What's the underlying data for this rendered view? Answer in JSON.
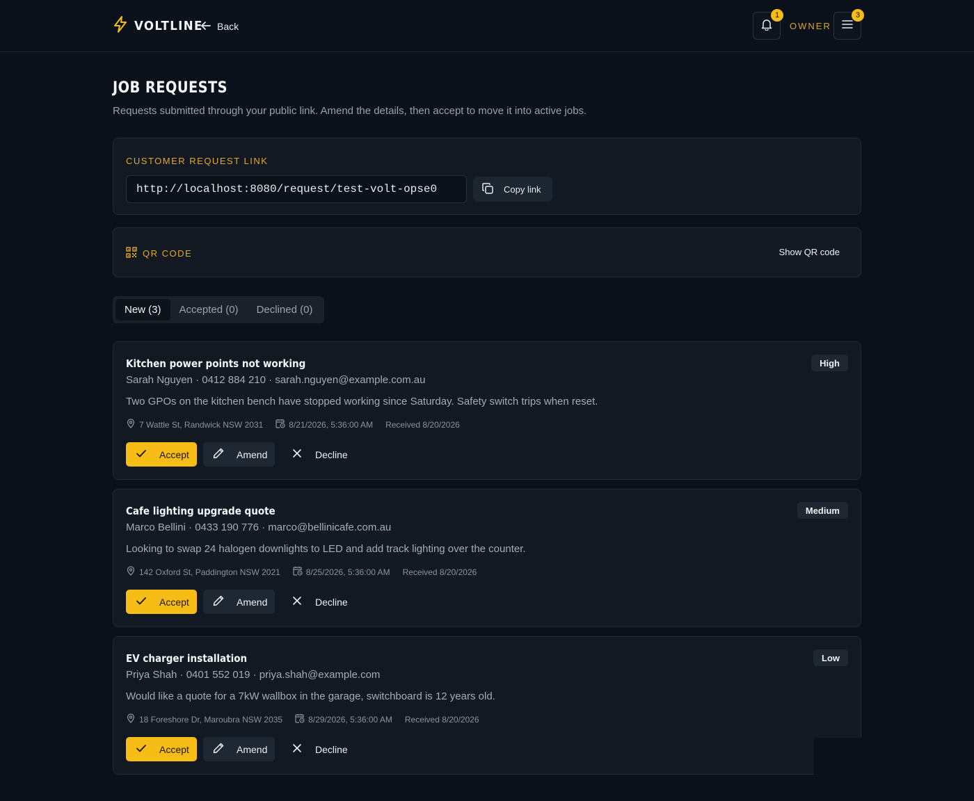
{
  "header": {
    "brand": "VOLTLINE",
    "back_label": "Back",
    "notifications_count": "1",
    "role_label": "OWNER",
    "menu_count": "3"
  },
  "page": {
    "title": "JOB REQUESTS",
    "subtitle": "Requests submitted through your public link. Amend the details, then accept to move it into active jobs."
  },
  "request_link": {
    "label": "CUSTOMER REQUEST LINK",
    "url": "http://localhost:8080/request/test-volt-opse0",
    "copy_label": "Copy link"
  },
  "qr": {
    "label": "QR CODE",
    "show_label": "Show QR code"
  },
  "tabs": [
    {
      "label": "New (3)",
      "active": true
    },
    {
      "label": "Accepted (0)",
      "active": false
    },
    {
      "label": "Declined (0)",
      "active": false
    }
  ],
  "actions": {
    "accept": "Accept",
    "amend": "Amend",
    "decline": "Decline"
  },
  "jobs": [
    {
      "title": "Kitchen power points not working",
      "contact": "Sarah Nguyen · 0412 884 210 · sarah.nguyen@example.com.au",
      "description": "Two GPOs on the kitchen bench have stopped working since Saturday. Safety switch trips when reset.",
      "address": "7 Wattle St, Randwick NSW 2031",
      "scheduled": "8/21/2026, 5:36:00 AM",
      "received": "Received 8/20/2026",
      "priority": "High"
    },
    {
      "title": "Cafe lighting upgrade quote",
      "contact": "Marco Bellini · 0433 190 776 · marco@bellinicafe.com.au",
      "description": "Looking to swap 24 halogen downlights to LED and add track lighting over the counter.",
      "address": "142 Oxford St, Paddington NSW 2021",
      "scheduled": "8/25/2026, 5:36:00 AM",
      "received": "Received 8/20/2026",
      "priority": "Medium"
    },
    {
      "title": "EV charger installation",
      "contact": "Priya Shah · 0401 552 019 · priya.shah@example.com",
      "description": "Would like a quote for a 7kW wallbox in the garage, switchboard is 12 years old.",
      "address": "18 Foreshore Dr, Maroubra NSW 2035",
      "scheduled": "8/29/2026, 5:36:00 AM",
      "received": "Received 8/20/2026",
      "priority": "Low"
    }
  ],
  "colors": {
    "background": "#0b111a",
    "panel": "#121923",
    "accent": "#f6bd16",
    "accent_text": "#e3aa23"
  }
}
